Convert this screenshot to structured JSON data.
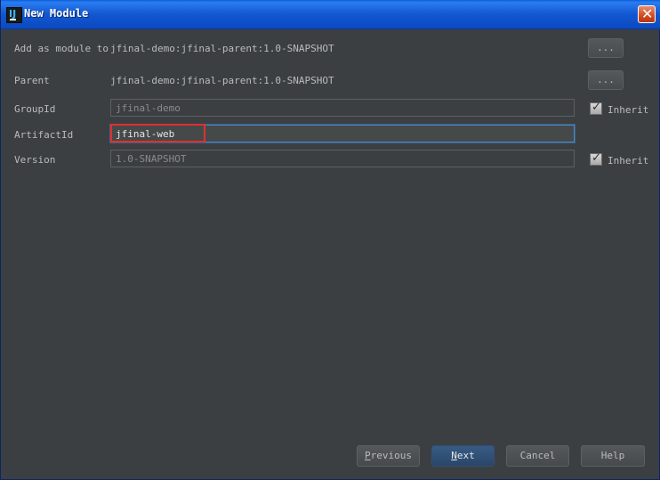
{
  "window": {
    "title": "New Module",
    "close_glyph": "✕"
  },
  "form": {
    "add_as_module": {
      "label": "Add as module to",
      "value": "jfinal-demo:jfinal-parent:1.0-SNAPSHOT",
      "button": "..."
    },
    "parent": {
      "label": "Parent",
      "value": "jfinal-demo:jfinal-parent:1.0-SNAPSHOT",
      "button": "..."
    },
    "group_id": {
      "label": "GroupId",
      "value": "jfinal-demo",
      "inherit_label": "Inherit",
      "inherit_checked": true
    },
    "artifact_id": {
      "label": "ArtifactId",
      "value": "jfinal-web"
    },
    "version": {
      "label": "Version",
      "value": "1.0-SNAPSHOT",
      "inherit_label": "Inherit",
      "inherit_checked": true
    }
  },
  "buttons": {
    "previous": {
      "mnemonic": "P",
      "rest": "revious"
    },
    "next": {
      "mnemonic": "N",
      "rest": "ext"
    },
    "cancel": "Cancel",
    "help": "Help"
  },
  "icons": {
    "app": "intellij-icon",
    "check": "✓"
  },
  "colors": {
    "highlight": "#e03030",
    "focus": "#4a88c7",
    "titlebar": "#1257d0"
  }
}
